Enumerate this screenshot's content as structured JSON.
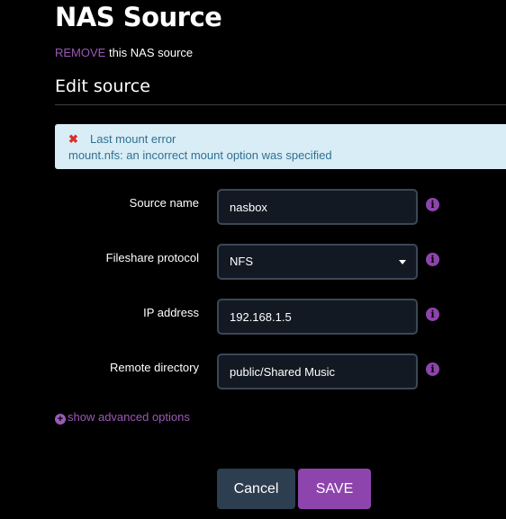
{
  "page": {
    "title": "NAS Source",
    "remove_link": "REMOVE",
    "remove_suffix": " this NAS source",
    "section_title": "Edit source"
  },
  "alert": {
    "icon": "error-x-icon",
    "heading": "Last mount error",
    "message": "mount.nfs: an incorrect mount option was specified"
  },
  "form": {
    "source_name": {
      "label": "Source name",
      "value": "nasbox"
    },
    "protocol": {
      "label": "Fileshare protocol",
      "value": "NFS",
      "options": [
        "NFS"
      ]
    },
    "ip_address": {
      "label": "IP address",
      "value": "192.168.1.5"
    },
    "remote_directory": {
      "label": "Remote directory",
      "value": "public/Shared Music"
    },
    "info_glyph": "i"
  },
  "advanced": {
    "label": "show advanced options",
    "icon_glyph": "+"
  },
  "buttons": {
    "cancel": "Cancel",
    "save": "SAVE"
  },
  "colors": {
    "accent": "#8e44ad",
    "link": "#9b59b6",
    "alert_bg": "#d9edf7",
    "alert_text": "#31708f",
    "error_x": "#d9302b",
    "input_bg": "#121922",
    "cancel_bg": "#2c3e50"
  }
}
